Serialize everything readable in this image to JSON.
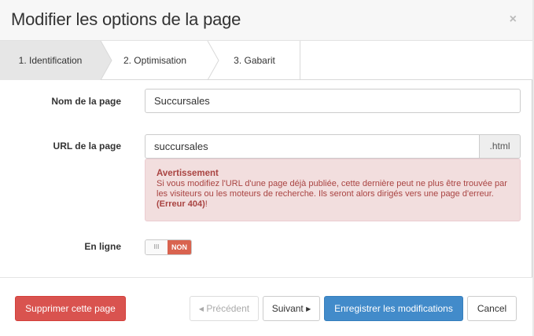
{
  "header": {
    "title": "Modifier les options de la page",
    "close": "×"
  },
  "steps": [
    {
      "label": "1. Identification"
    },
    {
      "label": "2. Optimisation"
    },
    {
      "label": "3. Gabarit"
    }
  ],
  "form": {
    "name_label": "Nom de la page",
    "name_value": "Succursales",
    "url_label": "URL de la page",
    "url_value": "succursales",
    "url_suffix": ".html",
    "online_label": "En ligne",
    "online_handle": "III",
    "online_state": "NON"
  },
  "alert": {
    "title": "Avertissement",
    "text": "Si vous modifiez l'URL d'une page déjà publiée, cette dernière peut ne plus être trouvée par les visiteurs ou les moteurs de recherche. Ils seront alors dirigés vers une page d'erreur. ",
    "code": "(Erreur 404)",
    "end": "!"
  },
  "footer": {
    "delete": "Supprimer cette page",
    "previous": "Précédent",
    "next": "Suivant",
    "save": "Enregistrer les modifications",
    "cancel": "Cancel"
  },
  "colors": {
    "danger": "#d9534f",
    "primary": "#428bca",
    "alert_bg": "#f2dede",
    "alert_text": "#a94442"
  }
}
